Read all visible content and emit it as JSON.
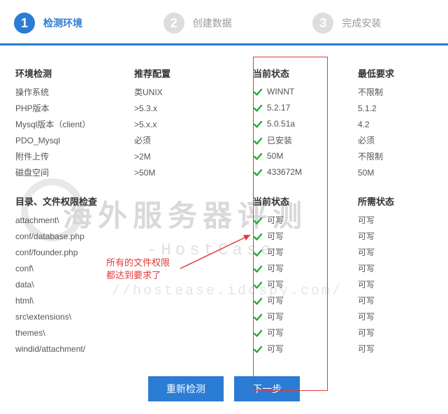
{
  "steps": [
    {
      "num": "1",
      "label": "检测环境",
      "state": "active"
    },
    {
      "num": "2",
      "label": "创建数据",
      "state": "inactive"
    },
    {
      "num": "3",
      "label": "完成安装",
      "state": "inactive"
    }
  ],
  "env_header": {
    "c0": "环境检测",
    "c1": "推荐配置",
    "c2": "当前状态",
    "c3": "最低要求"
  },
  "env_rows": [
    {
      "k": "操作系统",
      "rec": "类UNIX",
      "cur": "WINNT",
      "min": "不限制"
    },
    {
      "k": "PHP版本",
      "rec": ">5.3.x",
      "cur": "5.2.17",
      "min": "5.1.2"
    },
    {
      "k": "Mysql版本（client）",
      "rec": ">5.x.x",
      "cur": "5.0.51a",
      "min": "4.2"
    },
    {
      "k": "PDO_Mysql",
      "rec": "必须",
      "cur": "已安装",
      "min": "必须"
    },
    {
      "k": "附件上传",
      "rec": ">2M",
      "cur": "50M",
      "min": "不限制"
    },
    {
      "k": "磁盘空间",
      "rec": ">50M",
      "cur": "433672M",
      "min": "50M"
    }
  ],
  "perm_header": {
    "c0": "目录、文件权限检查",
    "c2": "当前状态",
    "c3": "所需状态"
  },
  "perm_rows": [
    {
      "k": "attachment\\",
      "cur": "可写",
      "req": "可写"
    },
    {
      "k": "conf/database.php",
      "cur": "可写",
      "req": "可写"
    },
    {
      "k": "conf/founder.php",
      "cur": "可写",
      "req": "可写"
    },
    {
      "k": "conf\\",
      "cur": "可写",
      "req": "可写"
    },
    {
      "k": "data\\",
      "cur": "可写",
      "req": "可写"
    },
    {
      "k": "html\\",
      "cur": "可写",
      "req": "可写"
    },
    {
      "k": "src\\extensions\\",
      "cur": "可写",
      "req": "可写"
    },
    {
      "k": "themes\\",
      "cur": "可写",
      "req": "可写"
    },
    {
      "k": "windid/attachment/",
      "cur": "可写",
      "req": "可写"
    }
  ],
  "annotation": {
    "line1": "所有的文件权限",
    "line2": "都达到要求了"
  },
  "buttons": {
    "recheck": "重新检测",
    "next": "下一步"
  },
  "watermark": {
    "t1": "海外服务器评测",
    "t2": "-HostCase-",
    "t3": "//hostease.idcspy.com/"
  }
}
